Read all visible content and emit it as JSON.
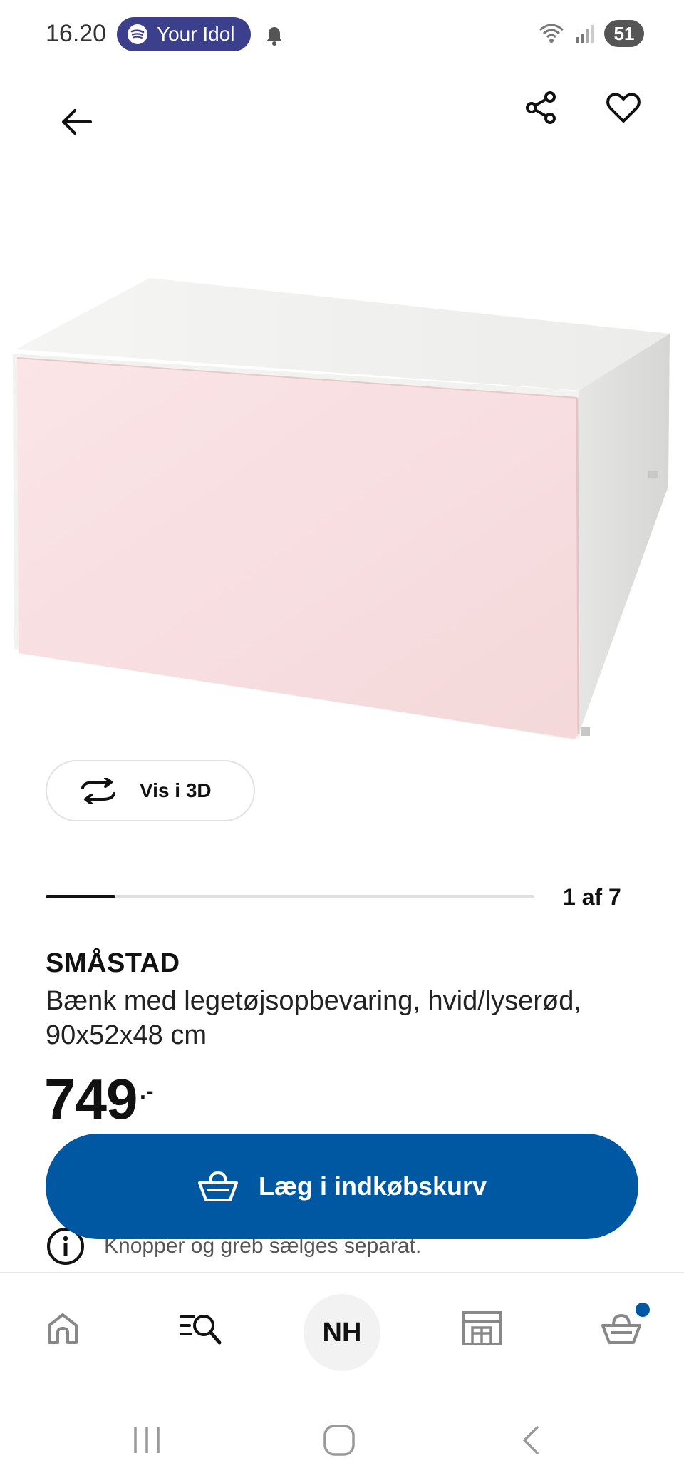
{
  "status_bar": {
    "time": "16.20",
    "media_label": "Your Idol",
    "battery": "51"
  },
  "gallery": {
    "view_3d_label": "Vis i 3D",
    "counter": "1 af 7",
    "current_index": 1,
    "total": 7
  },
  "product": {
    "name": "SMÅSTAD",
    "description": "Bænk med legetøjsopbevaring, hvid/lyserød, 90x52x48 cm",
    "price": "749",
    "price_suffix": ".-",
    "info_text": "Knopper og greb sælges separat."
  },
  "cta": {
    "add_to_cart_label": "Læg i indkøbskurv"
  },
  "bottom_nav": {
    "avatar_initials": "NH",
    "items": [
      "home-icon",
      "search-icon",
      "profile-avatar",
      "store-icon",
      "cart-icon"
    ]
  },
  "colors": {
    "accent": "#0058a3",
    "media_pill": "#3b3f8c",
    "product_front": "#f7dfe1"
  }
}
